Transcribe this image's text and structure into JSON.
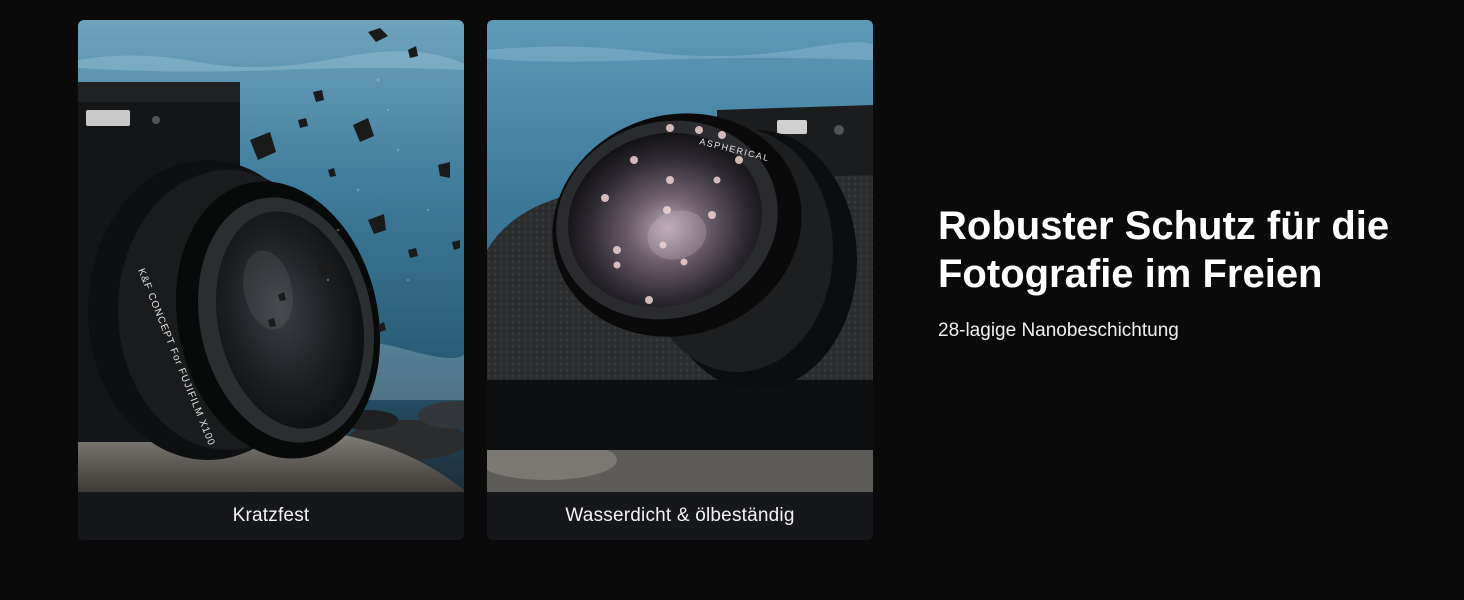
{
  "cards": [
    {
      "caption": "Kratzfest",
      "photo_subject": "camera-filter-debris-photo"
    },
    {
      "caption": "Wasserdicht & ölbeständig",
      "photo_subject": "camera-lens-droplets-photo"
    }
  ],
  "heading": {
    "title": "Robuster Schutz für die Fotografie im Freien",
    "subtitle": "28-lagige Nanobeschichtung"
  },
  "lens_markings": {
    "filter_text": "K&F CONCEPT For FUJIFILM X100",
    "lens_text": "ASPHERICAL"
  },
  "colors": {
    "background": "#0a0a0a",
    "caption_bar": "#16171b",
    "text": "#ffffff",
    "sea": "#3f7fa0"
  }
}
